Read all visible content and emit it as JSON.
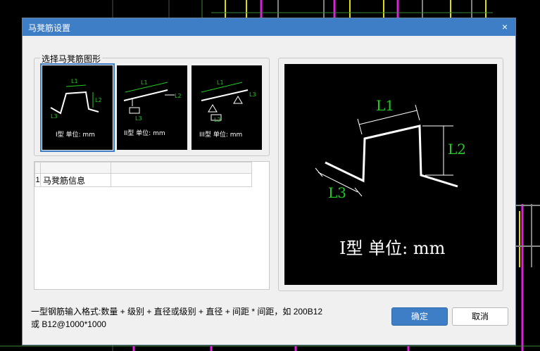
{
  "dialog": {
    "title": "马凳筋设置",
    "close_glyph": "×"
  },
  "shape_group": {
    "label": "选择马凳筋图形",
    "shapes": [
      {
        "caption": "I型 单位: mm",
        "selected": true
      },
      {
        "caption": "II型 单位: mm",
        "selected": false
      },
      {
        "caption": "III型 单位: mm",
        "selected": false
      }
    ],
    "dim_labels": {
      "l1": "L1",
      "l2": "L2",
      "l3": "L3"
    }
  },
  "info_table": {
    "rows": [
      {
        "index": "1",
        "name": "马凳筋信息",
        "value": ""
      }
    ]
  },
  "preview": {
    "caption": "I型 单位: mm",
    "dim_labels": {
      "l1": "L1",
      "l2": "L2",
      "l3": "L3"
    },
    "dim_color": "#22cc22",
    "shape_color": "#ffffff"
  },
  "footer": {
    "hint_line1": "一型钢筋输入格式:数量 + 级别 + 直径或级别 + 直径 + 间距 * 间距，如 200B12",
    "hint_line2": "或 B12@1000*1000",
    "ok_label": "确定",
    "cancel_label": "取消"
  }
}
